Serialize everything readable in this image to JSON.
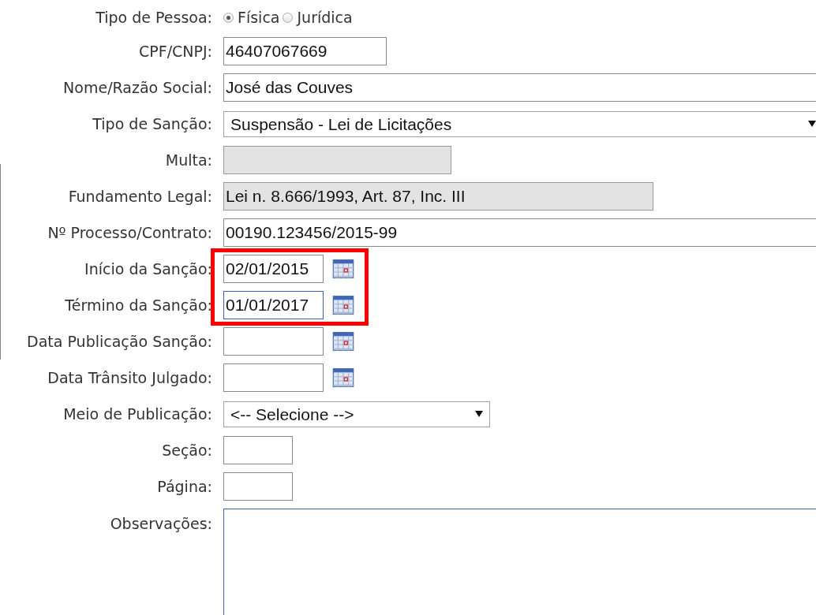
{
  "form": {
    "rows": [
      {
        "label": "Tipo de Pessoa:",
        "kind": "radio",
        "options": [
          {
            "label": "Física",
            "selected": true
          },
          {
            "label": "Jurídica",
            "selected": false
          }
        ]
      },
      {
        "label": "CPF/CNPJ:",
        "kind": "text",
        "value": "46407067669"
      },
      {
        "label": "Nome/Razão Social:",
        "kind": "text",
        "value": "José das Couves"
      },
      {
        "label": "Tipo de Sanção:",
        "kind": "select",
        "value": "Suspensão - Lei de Licitações"
      },
      {
        "label": "Multa:",
        "kind": "text",
        "disabled": true
      },
      {
        "label": "Fundamento Legal:",
        "kind": "text",
        "value": "Lei n. 8.666/1993, Art. 87, Inc. III",
        "disabled": true
      },
      {
        "label": "Nº Processo/Contrato:",
        "kind": "text",
        "value": "00190.123456/2015-99"
      },
      {
        "label": "Início da Sanção:",
        "kind": "date",
        "value": "02/01/2015",
        "highlighted": true
      },
      {
        "label": "Término da Sanção:",
        "kind": "date",
        "value": "01/01/2017",
        "focused": true,
        "highlighted": true
      },
      {
        "label": "Data Publicação Sanção:",
        "kind": "date"
      },
      {
        "label": "Data Trânsito Julgado:",
        "kind": "date"
      },
      {
        "label": "Meio de Publicação:",
        "kind": "select",
        "value": "<-- Selecione -->"
      },
      {
        "label": "Seção:",
        "kind": "text"
      },
      {
        "label": "Página:",
        "kind": "text"
      },
      {
        "label": "Observações:",
        "kind": "textarea",
        "focused": true
      }
    ]
  }
}
